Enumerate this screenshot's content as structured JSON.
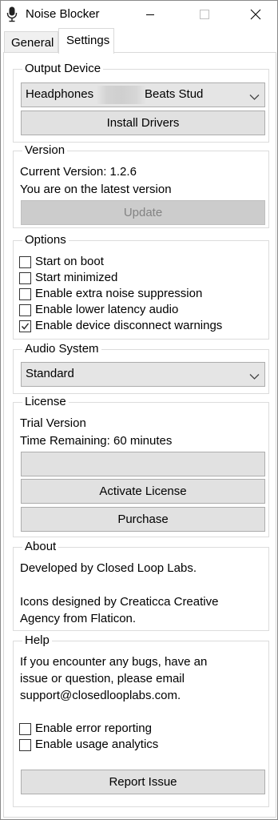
{
  "window": {
    "title": "Noise Blocker",
    "app_icon": "microphone-icon"
  },
  "tabs": [
    {
      "label": "General",
      "active": false
    },
    {
      "label": "Settings",
      "active": true
    }
  ],
  "output_device": {
    "legend": "Output Device",
    "selected_left": "Headphones",
    "selected_right": "Beats Stud",
    "install_button": "Install Drivers"
  },
  "version": {
    "legend": "Version",
    "current": "Current Version: 1.2.6",
    "status": "You are on the latest version",
    "update_button": "Update"
  },
  "options": {
    "legend": "Options",
    "items": [
      {
        "label": "Start on boot",
        "checked": false
      },
      {
        "label": "Start minimized",
        "checked": false
      },
      {
        "label": "Enable extra noise suppression",
        "checked": false
      },
      {
        "label": "Enable lower latency audio",
        "checked": false
      },
      {
        "label": "Enable device disconnect warnings",
        "checked": true
      }
    ]
  },
  "audio_system": {
    "legend": "Audio System",
    "selected": "Standard"
  },
  "license": {
    "legend": "License",
    "type": "Trial Version",
    "remaining": "Time Remaining: 60 minutes",
    "key_value": "",
    "activate_button": "Activate License",
    "purchase_button": "Purchase"
  },
  "about": {
    "legend": "About",
    "line1": "Developed by Closed Loop Labs.",
    "line2": "Icons designed by Creaticca Creative",
    "line3": "Agency from Flaticon."
  },
  "help": {
    "legend": "Help",
    "line1": "If you encounter any bugs, have an",
    "line2": "issue or question, please email",
    "line3": "support@closedlooplabs.com.",
    "items": [
      {
        "label": "Enable error reporting",
        "checked": false
      },
      {
        "label": "Enable usage analytics",
        "checked": false
      }
    ],
    "report_button": "Report Issue"
  }
}
